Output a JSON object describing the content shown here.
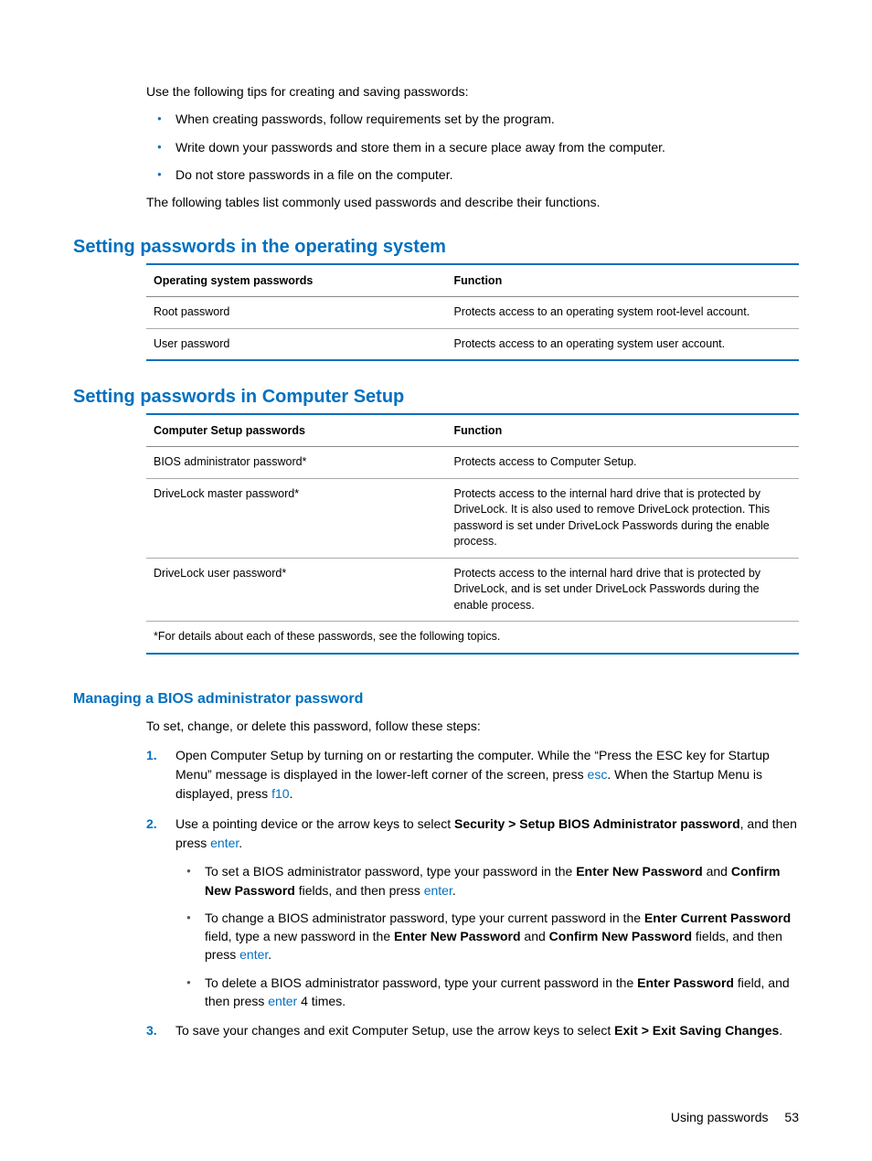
{
  "intro": {
    "line1": "Use the following tips for creating and saving passwords:",
    "tips": [
      "When creating passwords, follow requirements set by the program.",
      "Write down your passwords and store them in a secure place away from the computer.",
      "Do not store passwords in a file on the computer."
    ],
    "line2": "The following tables list commonly used passwords and describe their functions."
  },
  "os_section": {
    "heading": "Setting passwords in the operating system",
    "th1": "Operating system passwords",
    "th2": "Function",
    "rows": [
      {
        "c1": "Root password",
        "c2": "Protects access to an operating system root-level account."
      },
      {
        "c1": "User password",
        "c2": "Protects access to an operating system user account."
      }
    ]
  },
  "cs_section": {
    "heading": "Setting passwords in Computer Setup",
    "th1": "Computer Setup passwords",
    "th2": "Function",
    "rows": [
      {
        "c1": "BIOS administrator password*",
        "c2": "Protects access to Computer Setup."
      },
      {
        "c1": "DriveLock master password*",
        "c2": "Protects access to the internal hard drive that is protected by DriveLock. It is also used to remove DriveLock protection. This password is set under DriveLock Passwords during the enable process."
      },
      {
        "c1": "DriveLock user password*",
        "c2": "Protects access to the internal hard drive that is protected by DriveLock, and is set under DriveLock Passwords during the enable process."
      }
    ],
    "footnote": "*For details about each of these passwords, see the following topics."
  },
  "bios_section": {
    "heading": "Managing a BIOS administrator password",
    "intro": "To set, change, or delete this password, follow these steps:",
    "step1": {
      "a": "Open Computer Setup by turning on or restarting the computer. While the “Press the ESC key for Startup Menu” message is displayed in the lower-left corner of the screen, press ",
      "key1": "esc",
      "b": ". When the Startup Menu is displayed, press ",
      "key2": "f10",
      "c": "."
    },
    "step2": {
      "a": "Use a pointing device or the arrow keys to select ",
      "bold": "Security > Setup BIOS Administrator password",
      "b": ", and then press ",
      "key": "enter",
      "c": ".",
      "sub": [
        {
          "a": "To set a BIOS administrator password, type your password in the ",
          "b1": "Enter New Password",
          "b": " and ",
          "b2": "Confirm New Password",
          "c": " fields, and then press ",
          "key": "enter",
          "d": "."
        },
        {
          "a": "To change a BIOS administrator password, type your current password in the ",
          "b1": "Enter Current Password",
          "b": " field, type a new password in the ",
          "b2": "Enter New Password",
          "c": " and ",
          "b3": "Confirm New Password",
          "d": " fields, and then press ",
          "key": "enter",
          "e": "."
        },
        {
          "a": "To delete a BIOS administrator password, type your current password in the ",
          "b1": "Enter Password",
          "b": " field, and then press ",
          "key": "enter",
          "c": " 4 times."
        }
      ]
    },
    "step3": {
      "a": "To save your changes and exit Computer Setup, use the arrow keys to select ",
      "bold": "Exit > Exit Saving Changes",
      "b": "."
    }
  },
  "footer": {
    "text": "Using passwords",
    "page": "53"
  }
}
